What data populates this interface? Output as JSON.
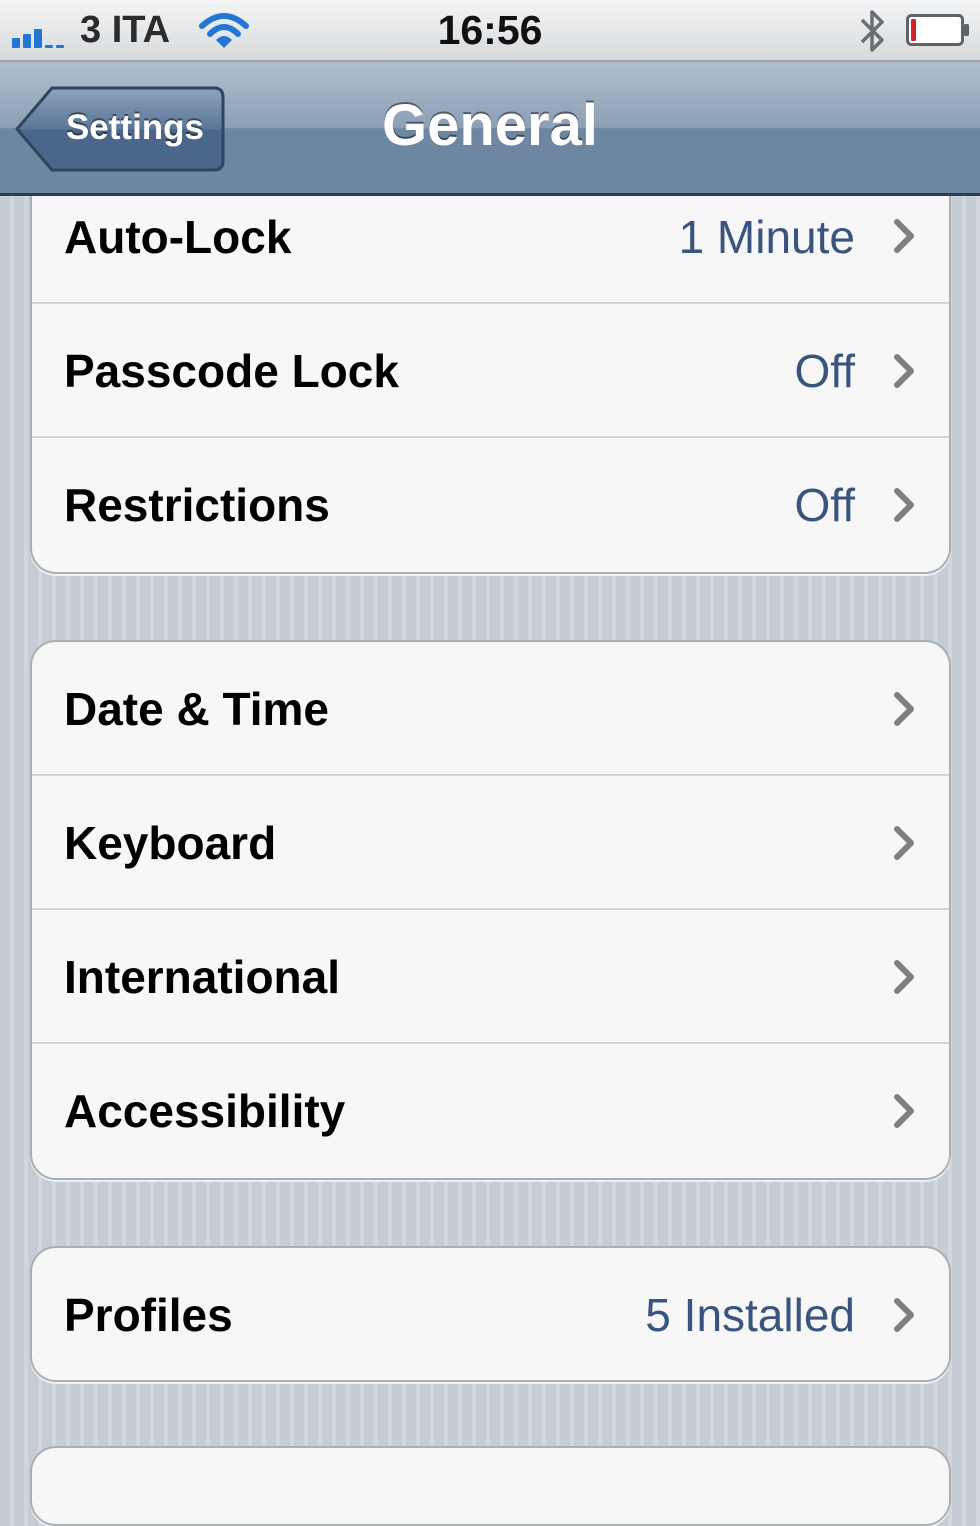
{
  "status_bar": {
    "carrier": "3 ITA",
    "time": "16:56",
    "icons": [
      "signal-strength-icon",
      "wifi-icon",
      "bluetooth-icon",
      "battery-icon"
    ],
    "signal_bars": 3,
    "battery_level": 0.08
  },
  "nav": {
    "back_label": "Settings",
    "title": "General"
  },
  "groups": [
    {
      "rows": [
        {
          "label": "Auto-Lock",
          "value": "1 Minute"
        },
        {
          "label": "Passcode Lock",
          "value": "Off"
        },
        {
          "label": "Restrictions",
          "value": "Off"
        }
      ]
    },
    {
      "rows": [
        {
          "label": "Date & Time",
          "value": ""
        },
        {
          "label": "Keyboard",
          "value": ""
        },
        {
          "label": "International",
          "value": ""
        },
        {
          "label": "Accessibility",
          "value": ""
        }
      ]
    },
    {
      "rows": [
        {
          "label": "Profiles",
          "value": "5 Installed"
        }
      ]
    }
  ],
  "colors": {
    "value_text": "#3a5480",
    "nav_bar": "#6d87a3",
    "signal": "#2377d2",
    "battery_low": "#d8202a"
  }
}
